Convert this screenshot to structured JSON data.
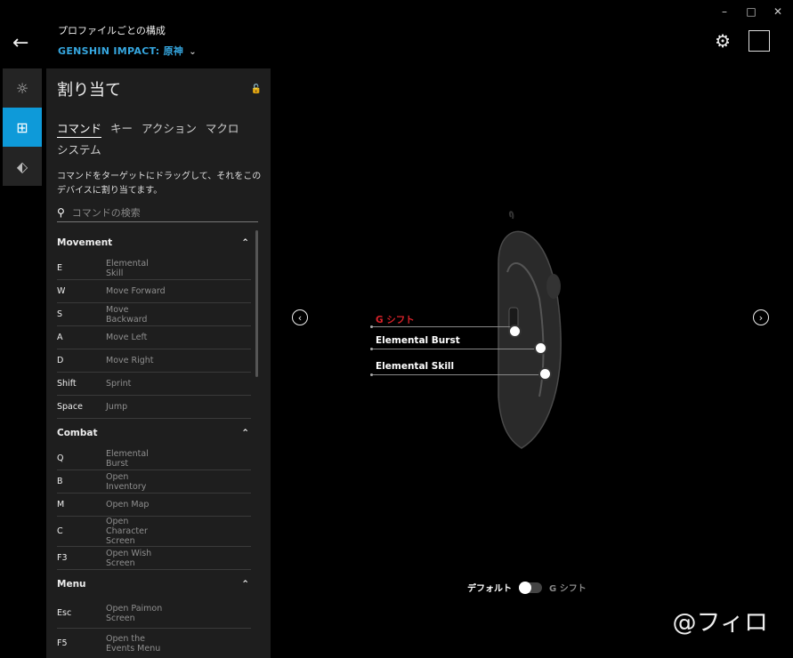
{
  "window": {
    "minimize": "–",
    "maximize": "□",
    "close": "✕"
  },
  "header": {
    "back": "←",
    "title": "プロファイルごとの構成",
    "game": "GENSHIN IMPACT: 原神",
    "chevron": "⌄",
    "gear": "⚙"
  },
  "sidebar": [
    "☼",
    "⊞",
    "⬖"
  ],
  "panel": {
    "title": "割り当て",
    "lock": "🔓",
    "tabs": [
      "コマンド",
      "キー",
      "アクション",
      "マクロ",
      "システム"
    ],
    "description": "コマンドをターゲットにドラッグして、それをこのデバイスに割り当てます。",
    "search_placeholder": "コマンドの検索",
    "sections": [
      {
        "name": "Movement",
        "rows": [
          {
            "key": "E",
            "action": "Elemental Skill"
          },
          {
            "key": "W",
            "action": "Move Forward"
          },
          {
            "key": "S",
            "action": "Move Backward"
          },
          {
            "key": "A",
            "action": "Move Left"
          },
          {
            "key": "D",
            "action": "Move Right"
          },
          {
            "key": "Shift",
            "action": "Sprint"
          },
          {
            "key": "Space",
            "action": "Jump"
          }
        ]
      },
      {
        "name": "Combat",
        "rows": [
          {
            "key": "Q",
            "action": "Elemental Burst"
          },
          {
            "key": "B",
            "action": "Open Inventory"
          },
          {
            "key": "M",
            "action": "Open Map"
          },
          {
            "key": "C",
            "action": "Open Character Screen"
          },
          {
            "key": "F3",
            "action": "Open Wish Screen"
          }
        ]
      },
      {
        "name": "Menu",
        "rows": [
          {
            "key": "Esc",
            "action": "Open Paimon Screen"
          },
          {
            "key": "F5",
            "action": "Open the Events Menu"
          }
        ]
      }
    ]
  },
  "device": {
    "labels": {
      "gshift": "G シフト",
      "burst": "Elemental Burst",
      "skill": "Elemental Skill"
    },
    "nav_prev": "‹",
    "nav_next": "›"
  },
  "toggle": {
    "left": "デフォルト",
    "right": "G シフト"
  },
  "watermark": "@フィロ"
}
